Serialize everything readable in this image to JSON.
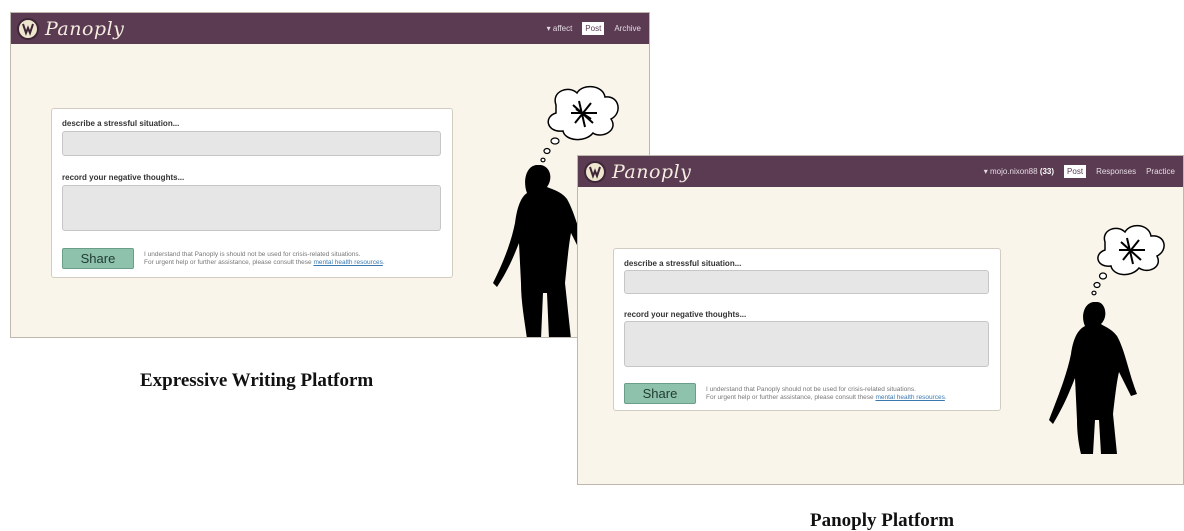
{
  "panels": [
    {
      "app_name": "Panoply",
      "nav": {
        "user": "▾ affect",
        "post": "Post",
        "archive": "Archive"
      },
      "form": {
        "situation_label": "describe a stressful situation...",
        "thoughts_label": "record your negative thoughts...",
        "share_label": "Share",
        "disclaimer_line1": "I understand that Panoply is should not be used for crisis-related situations.",
        "disclaimer_line2": "For urgent help or further assistance, please consult these",
        "resources_link": "mental health resources",
        "period": "."
      },
      "caption": "Expressive Writing Platform"
    },
    {
      "app_name": "Panoply",
      "nav": {
        "user": "▾ mojo.nixon88",
        "count": "(33)",
        "post": "Post",
        "responses": "Responses",
        "practice": "Practice"
      },
      "form": {
        "situation_label": "describe a stressful situation...",
        "thoughts_label": "record your negative thoughts...",
        "share_label": "Share",
        "disclaimer_line1": "I understand that Panoply should not be used for crisis-related situations.",
        "disclaimer_line2": "For urgent help or further assistance, please consult these",
        "resources_link": "mental health resources",
        "period": "."
      },
      "caption": "Panoply Platform"
    }
  ],
  "colors": {
    "navbar": "#5a3b52",
    "background": "#faf5ea",
    "share_button": "#8fc2ad",
    "link": "#3a78b0"
  },
  "icons": [
    "panoply-logo-icon",
    "thought-bubble-icon",
    "person-silhouette-icon"
  ]
}
